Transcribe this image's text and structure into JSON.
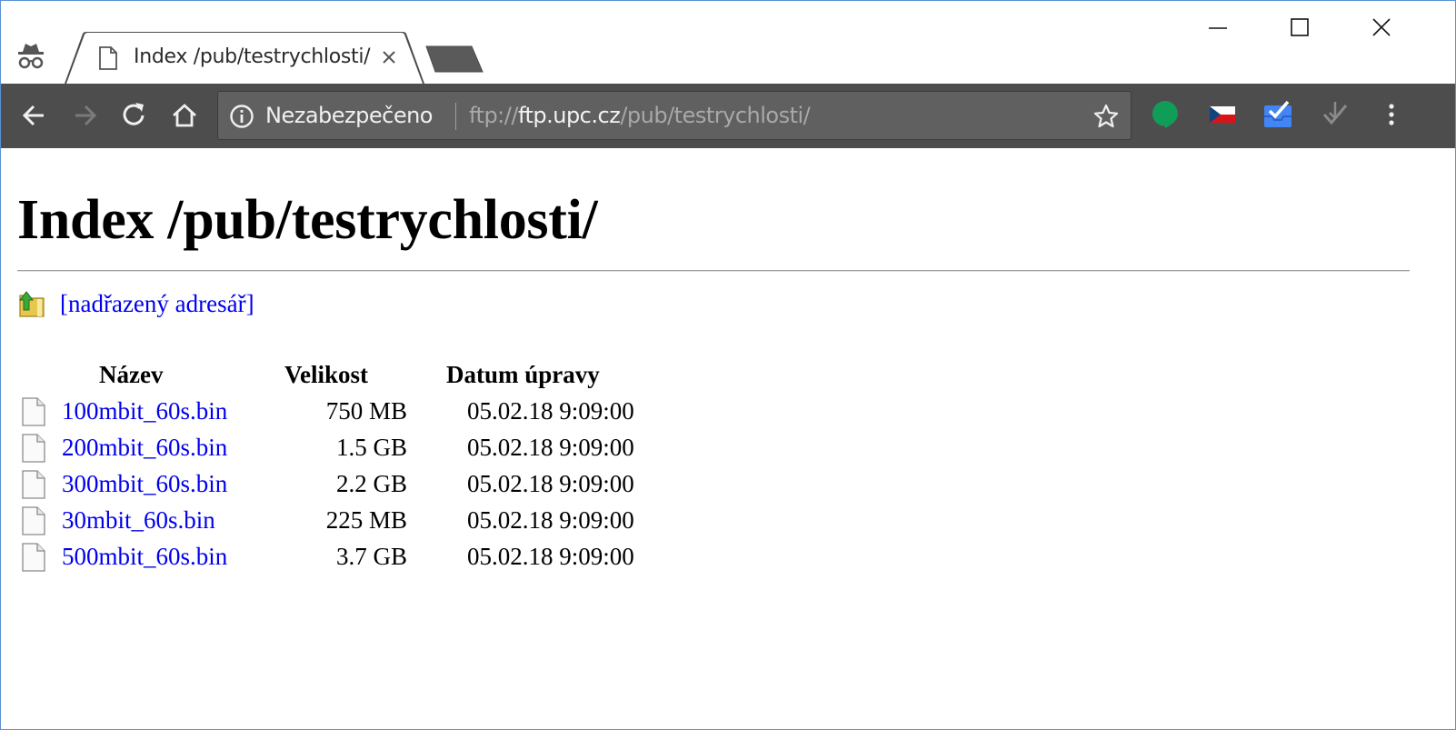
{
  "browser": {
    "tab": {
      "title": "Index /pub/testrychlosti/"
    },
    "omnibox": {
      "security_label": "Nezabezpečeno",
      "url_scheme": "ftp://",
      "url_host": "ftp.upc.cz",
      "url_path": "/pub/testrychlosti/"
    },
    "extensions": [
      "hangouts-icon",
      "czech-flag-icon",
      "inbox-icon",
      "feedly-icon"
    ],
    "colors": {
      "toolbar": "#4d4d4d",
      "omnibox": "#606060",
      "link": "#0000ee"
    }
  },
  "page": {
    "heading": "Index /pub/testrychlosti/",
    "parent_link": "[nadřazený adresář]",
    "columns": {
      "name": "Název",
      "size": "Velikost",
      "date": "Datum úpravy"
    },
    "files": [
      {
        "name": "100mbit_60s.bin",
        "size": "750 MB",
        "date": "05.02.18 9:09:00"
      },
      {
        "name": "200mbit_60s.bin",
        "size": "1.5 GB",
        "date": "05.02.18 9:09:00"
      },
      {
        "name": "300mbit_60s.bin",
        "size": "2.2 GB",
        "date": "05.02.18 9:09:00"
      },
      {
        "name": "30mbit_60s.bin",
        "size": "225 MB",
        "date": "05.02.18 9:09:00"
      },
      {
        "name": "500mbit_60s.bin",
        "size": "3.7 GB",
        "date": "05.02.18 9:09:00"
      }
    ]
  }
}
